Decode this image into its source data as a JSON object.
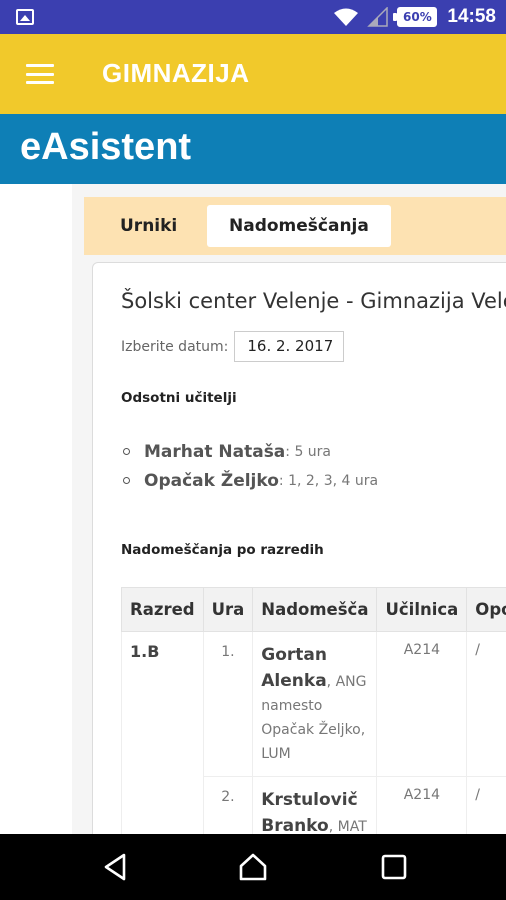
{
  "status_bar": {
    "time": "14:58",
    "battery": "60%",
    "icons": [
      "image-icon",
      "wifi-icon",
      "signal-icon",
      "battery-icon"
    ]
  },
  "app_bar": {
    "title": "GIMNAZIJA",
    "color": "#f1c92b"
  },
  "site_header": {
    "logo_text": "eAsistent",
    "color": "#0e7fb6"
  },
  "tabs": [
    {
      "label": "Urniki",
      "active": false
    },
    {
      "label": "Nadomeščanja",
      "active": true
    }
  ],
  "page": {
    "school_name": "Šolski center Velenje - Gimnazija Velenje",
    "date_label": "Izberite datum:",
    "date_value": "16. 2. 2017",
    "absent_title": "Odsotni učitelji",
    "absent_teachers": [
      {
        "name": "Marhat Nataša",
        "hours": ": 5 ura"
      },
      {
        "name": "Opačak Željko",
        "hours": ": 1, 2, 3, 4 ura"
      }
    ],
    "substitutions_title": "Nadomeščanja po razredih"
  },
  "table": {
    "headers": [
      "Razred",
      "Ura",
      "Nadomešča",
      "Učilnica",
      "Opomba"
    ],
    "rows": [
      {
        "razred": "1.B",
        "ura": "1.",
        "teacher": "Gortan Alenka",
        "detail": ", ANG namesto Opačak Željko, LUM",
        "ucilnica": "A214",
        "opomba": "/"
      },
      {
        "razred": "",
        "ura": "2.",
        "teacher": "Krstulovič Branko",
        "detail": ", MAT namesto Opačak Željko, LUM",
        "ucilnica": "A214",
        "opomba": "/"
      }
    ]
  },
  "nav_bar": {
    "icons": [
      "back-icon",
      "home-icon",
      "recent-apps-icon"
    ]
  }
}
